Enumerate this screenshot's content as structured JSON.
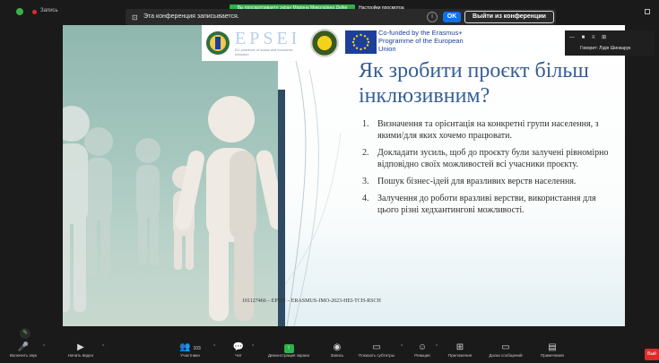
{
  "top": {
    "recording_label": "Запись",
    "banner": "Вы просматриваете экран Марина Миколаївна Дейні",
    "view_options": "Настройки просмотра",
    "notice_text": "Эта конференция записывается.",
    "info_glyph": "i",
    "ok_label": "OK",
    "leave_label": "Выйти из конференции"
  },
  "speaker": {
    "icons": "— ■ ≡ ⊞",
    "label": "Говорит: Лідія Шинкарук"
  },
  "slide": {
    "logos": {
      "epsei": "EPSEI",
      "epsei_sub": "EU practices of social and economic inclusion",
      "eu_text": "Co-funded by the Erasmus+ Programme of the European Union"
    },
    "title": "Як зробити проєкт більш інклюзивним?",
    "items": [
      {
        "num": "1.",
        "text": "Визначення та орієнтація на конкретні групи населення, з якими/для яких хочемо працювати."
      },
      {
        "num": "2.",
        "text": "Докладати зусиль, щоб до проєкту були залучені рівномірно відповідно своїх можливостей всі учасники проєкту."
      },
      {
        "num": "3.",
        "text": "Пошук бізнес-ідей для вразливих верств населення."
      },
      {
        "num": "4.",
        "text": "Залучення до роботи вразливі верстви, використання для цього різні хедхантингові можливості."
      }
    ],
    "footer": "101127466 – EPSEI – ERASMUS-JMO-2023-HEI-TCH-RSCH"
  },
  "toolbar": {
    "mute": "Включить звук",
    "video": "Начать видео",
    "participants": "Участники",
    "participants_count": "103",
    "chat": "Чат",
    "share": "Демонстрация экрана",
    "record": "Запись",
    "captions": "Показать субтитры",
    "reactions": "Реакции",
    "apps": "Приложения",
    "whiteboard": "Доски сообщений",
    "notes": "Примечания",
    "end": "Вый"
  },
  "icons": {
    "shield": "shield-icon",
    "pen": "pen-icon",
    "mic": "mic-muted-icon",
    "video": "video-off-icon",
    "participants": "people-icon",
    "chat": "chat-icon",
    "share": "share-screen-icon",
    "record": "record-icon",
    "captions": "cc-icon",
    "reactions": "emoji-icon",
    "apps": "apps-icon",
    "whiteboard": "whiteboard-icon",
    "notes": "notes-icon"
  },
  "colors": {
    "accent_blue": "#0e72ed",
    "share_green": "#2bb24a",
    "title_blue": "#355e93",
    "end_red": "#e02a2a"
  }
}
